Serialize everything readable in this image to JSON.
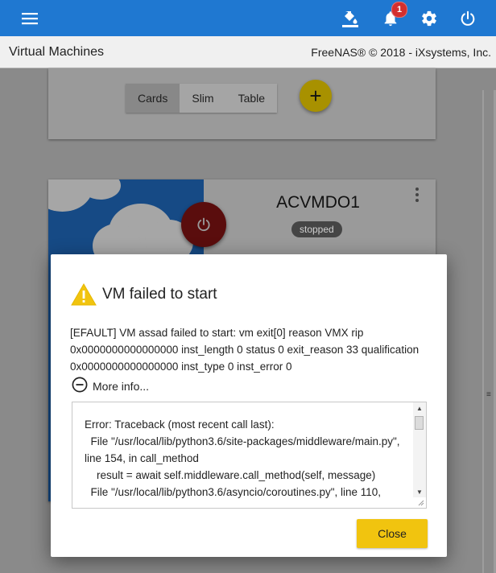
{
  "topbar": {
    "notification_count": "1",
    "icons": [
      "menu-icon",
      "paint-bucket-icon",
      "bell-icon",
      "gear-icon",
      "power-icon"
    ],
    "accent_color": "#1f78d1"
  },
  "titlebar": {
    "page_title": "Virtual Machines",
    "copyright": "FreeNAS® © 2018 - iXsystems, Inc."
  },
  "view_toggle": {
    "options": [
      "Cards",
      "Slim",
      "Table"
    ],
    "selected": "Cards"
  },
  "fab": {
    "label": "+"
  },
  "vm_card": {
    "name": "ACVMDO1",
    "state": "stopped"
  },
  "dialog": {
    "title": "VM failed to start",
    "message": "[EFAULT] VM assad failed to start: vm exit[0] reason VMX rip 0x0000000000000000 inst_length 0 status 0 exit_reason 33 qualification 0x0000000000000000 inst_type 0 inst_error 0",
    "more_info_label": "More info...",
    "traceback": "Error: Traceback (most recent call last):\n  File \"/usr/local/lib/python3.6/site-packages/middleware/main.py\", line 154, in call_method\n    result = await self.middleware.call_method(self, message)\n  File \"/usr/local/lib/python3.6/asyncio/coroutines.py\", line 110,",
    "close_label": "Close",
    "button_color": "#f1c40f"
  }
}
